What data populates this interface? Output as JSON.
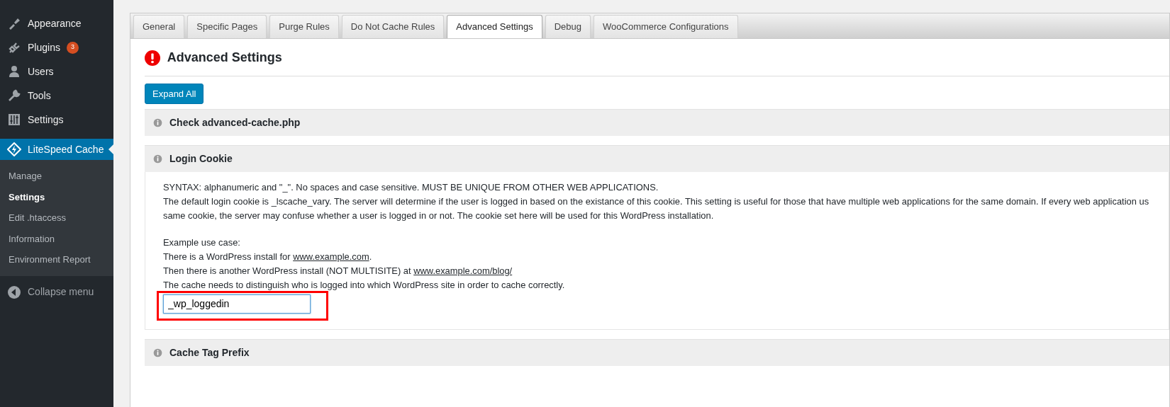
{
  "sidebar": {
    "items": [
      {
        "label": "Appearance",
        "selected": false
      },
      {
        "label": "Plugins",
        "badge": "3",
        "selected": false
      },
      {
        "label": "Users",
        "selected": false
      },
      {
        "label": "Tools",
        "selected": false
      },
      {
        "label": "Settings",
        "selected": false
      },
      {
        "label": "LiteSpeed Cache",
        "selected": true
      }
    ],
    "submenu": [
      {
        "label": "Manage",
        "selected": false
      },
      {
        "label": "Settings",
        "selected": true
      },
      {
        "label": "Edit .htaccess",
        "selected": false
      },
      {
        "label": "Information",
        "selected": false
      },
      {
        "label": "Environment Report",
        "selected": false
      }
    ],
    "collapse": "Collapse menu"
  },
  "tabs": [
    {
      "label": "General",
      "selected": false
    },
    {
      "label": "Specific Pages",
      "selected": false
    },
    {
      "label": "Purge Rules",
      "selected": false
    },
    {
      "label": "Do Not Cache Rules",
      "selected": false
    },
    {
      "label": "Advanced Settings",
      "selected": true
    },
    {
      "label": "Debug",
      "selected": false
    },
    {
      "label": "WooCommerce Configurations",
      "selected": false
    }
  ],
  "title": "Advanced Settings",
  "expand_button": "Expand All",
  "sections": [
    {
      "title": "Check advanced-cache.php"
    },
    {
      "title": "Login Cookie",
      "lines": [
        {
          "text": "SYNTAX: alphanumeric and \"_\". No spaces and case sensitive. MUST BE UNIQUE FROM OTHER WEB APPLICATIONS."
        },
        {
          "text": "The default login cookie is _lscache_vary. The server will determine if the user is logged in based on the existance of this cookie. This setting is useful for those that have multiple web applications for the same domain. If every web application us"
        },
        {
          "text": "same cookie, the server may confuse whether a user is logged in or not. The cookie set here will be used for this WordPress installation."
        },
        {
          "text": "Example use case:",
          "gap": true
        },
        {
          "text": "There is a WordPress install for",
          "link": "www.example.com",
          "after": "."
        },
        {
          "text": "Then there is another WordPress install (NOT MULTISITE) at",
          "link": "www.example.com/blog/"
        },
        {
          "text": "The cache needs to distinguish who is logged into which WordPress site in order to cache correctly."
        }
      ],
      "field": {
        "value": "_wp_loggedin",
        "highlighted": true
      }
    },
    {
      "title": "Cache Tag Prefix"
    }
  ]
}
